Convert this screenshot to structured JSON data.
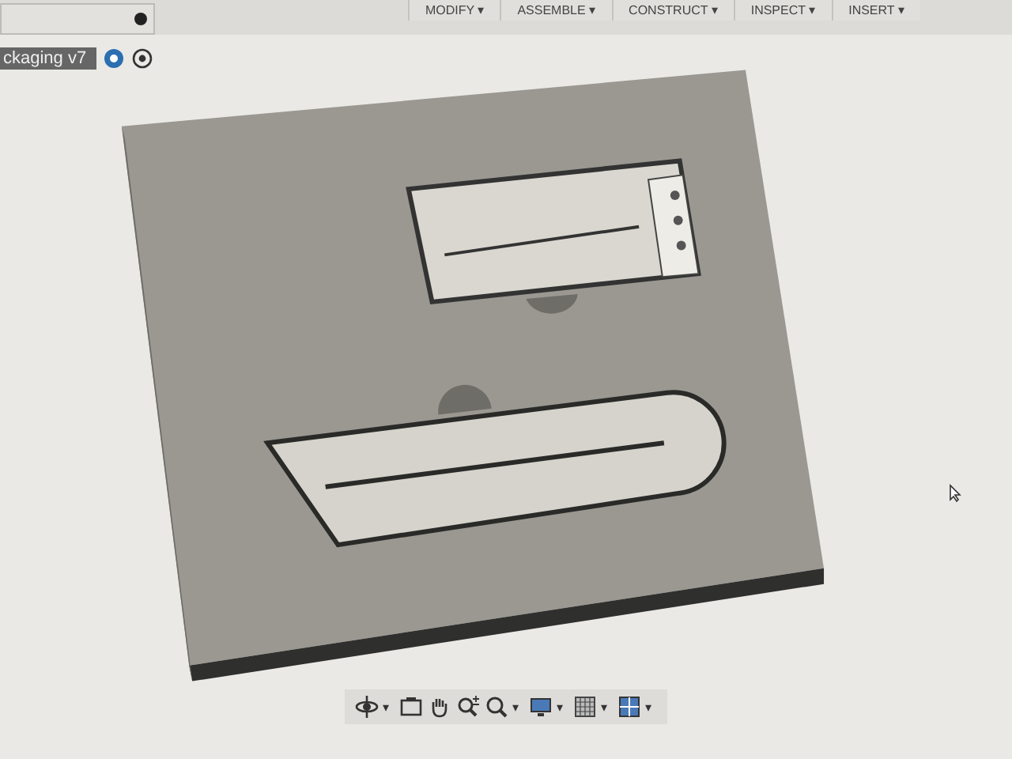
{
  "toolbar": {
    "menus": [
      {
        "label": "MODIFY ▾"
      },
      {
        "label": "ASSEMBLE ▾"
      },
      {
        "label": "CONSTRUCT ▾"
      },
      {
        "label": "INSPECT ▾"
      },
      {
        "label": "INSERT ▾"
      }
    ]
  },
  "document_tab": {
    "title": "ckaging v7"
  },
  "nav_bar": {
    "tools": [
      {
        "kind": "orbit",
        "caret": "▾"
      },
      {
        "kind": "look"
      },
      {
        "kind": "pan"
      },
      {
        "kind": "zoom"
      },
      {
        "kind": "fit",
        "caret": "▾"
      },
      {
        "kind": "display",
        "caret": "▾"
      },
      {
        "kind": "grid",
        "caret": "▾"
      },
      {
        "kind": "viewports",
        "caret": "▾"
      }
    ]
  }
}
